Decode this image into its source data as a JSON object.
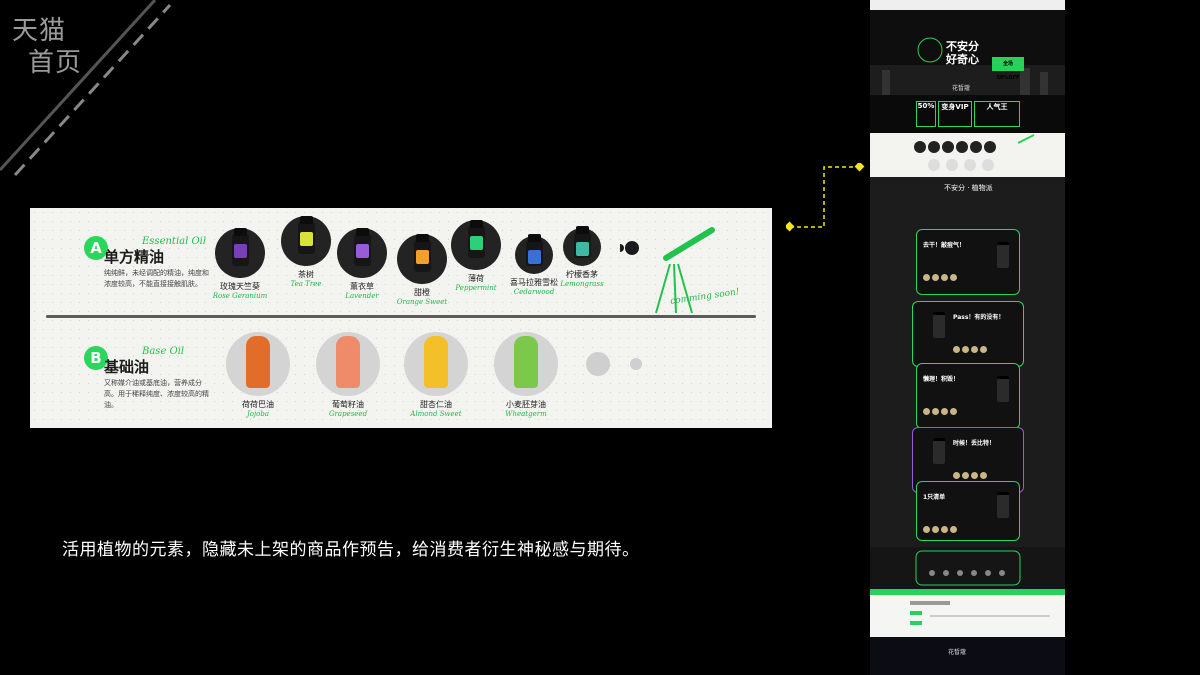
{
  "corner": {
    "line1": "天猫",
    "line2": "首页"
  },
  "panel": {
    "essential": {
      "badge": "A",
      "title": "单方精油",
      "en": "Essential Oil",
      "desc": "纯纯鲜，未经调配的精油，纯度和浓度较高，不能直接接触肌肤。",
      "products": [
        {
          "name": "玫瑰天竺葵",
          "en": "Rose Geranium",
          "label_color": "#7a3fb8"
        },
        {
          "name": "茶树",
          "en": "Tea Tree",
          "label_color": "#d8e23a"
        },
        {
          "name": "薰衣草",
          "en": "Lavender",
          "label_color": "#9a5bd8"
        },
        {
          "name": "甜橙",
          "en": "Orange Sweet",
          "label_color": "#f1a02b"
        },
        {
          "name": "薄荷",
          "en": "Peppermint",
          "label_color": "#2bd07a"
        },
        {
          "name": "喜马拉雅雪松",
          "en": "Cedarwood",
          "label_color": "#3a6fd8"
        },
        {
          "name": "柠檬香茅",
          "en": "Lemongrass",
          "label_color": "#3fb8a4"
        }
      ],
      "coming_soon": "comming soon!"
    },
    "base": {
      "badge": "B",
      "title": "基础油",
      "en": "Base Oil",
      "desc": "又称媒介油或基底油，营养成分高。用于稀释纯度、浓度较高的精油。",
      "products": [
        {
          "name": "荷荷巴油",
          "en": "Jojoba",
          "color": "#e26d2a"
        },
        {
          "name": "葡萄籽油",
          "en": "Grapeseed",
          "color": "#f08b6a"
        },
        {
          "name": "甜杏仁油",
          "en": "Almond Sweet",
          "color": "#f3c02a"
        },
        {
          "name": "小麦胚芽油",
          "en": "Wheatgerm",
          "color": "#7cc84a"
        }
      ]
    }
  },
  "caption": "活用植物的元素，隐藏未上架的商品作预告，给消费者衍生神秘感与期待。",
  "thumbnail": {
    "hero_title_1": "不安分",
    "hero_title_2": "好奇心",
    "hero_tag": "全场50%OFF",
    "logo": "花皙蔻",
    "vip_1": "50%",
    "vip_2": "变身VIP",
    "vip_3": "人气王",
    "dark_title": "不安分 · 植物派",
    "cards": [
      "去干！敲痘气！",
      "Pass！有的没有！",
      "懒理！积毁！",
      "时候！丢比特！",
      "1只清单"
    ],
    "footer": "花皙蔻"
  }
}
